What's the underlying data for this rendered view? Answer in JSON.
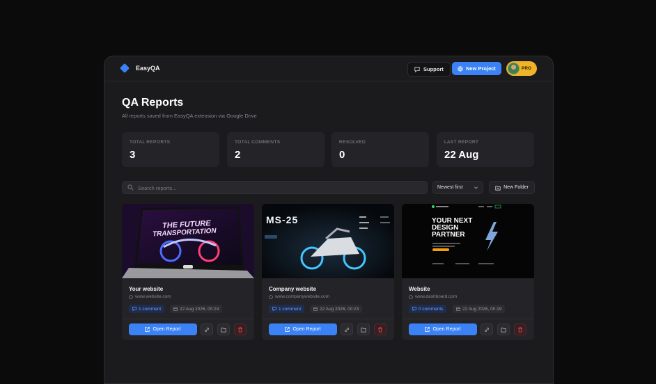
{
  "app": {
    "name": "EasyQA"
  },
  "header": {
    "support_label": "Support",
    "new_project_label": "New Project",
    "pro_label": "PRO"
  },
  "page": {
    "title": "QA Reports",
    "subtitle": "All reports saved from EasyQA extension via Google Drive"
  },
  "stats": [
    {
      "label": "Total Reports",
      "value": "3"
    },
    {
      "label": "Total Comments",
      "value": "2"
    },
    {
      "label": "Resolved",
      "value": "0"
    },
    {
      "label": "Last Report",
      "value": "22 Aug"
    }
  ],
  "toolbar": {
    "search_placeholder": "Search reports...",
    "sort_value": "Newest first",
    "new_folder_label": "New Folder"
  },
  "cards": [
    {
      "title": "Your website",
      "url": "www.website.com",
      "comments": "1 comment",
      "date": "22 Aug 2026, 00:24",
      "open_label": "Open Report",
      "thumb_text_1": "THE FUTURE",
      "thumb_text_2": "TRANSPORTATION"
    },
    {
      "title": "Company website",
      "url": "www.companywebsite.com",
      "comments": "1 comment",
      "date": "22 Aug 2026, 00:23",
      "open_label": "Open Report",
      "thumb_text_1": "MS-25"
    },
    {
      "title": "Website",
      "url": "www.dashboard.com",
      "comments": "0 comments",
      "date": "22 Aug 2026, 00:19",
      "open_label": "Open Report",
      "thumb_text_1": "YOUR NEXT",
      "thumb_text_2": "DESIGN",
      "thumb_text_3": "PARTNER"
    }
  ],
  "colors": {
    "accent": "#3b82f6",
    "pro": "#f0b429",
    "danger": "#e0464f"
  }
}
